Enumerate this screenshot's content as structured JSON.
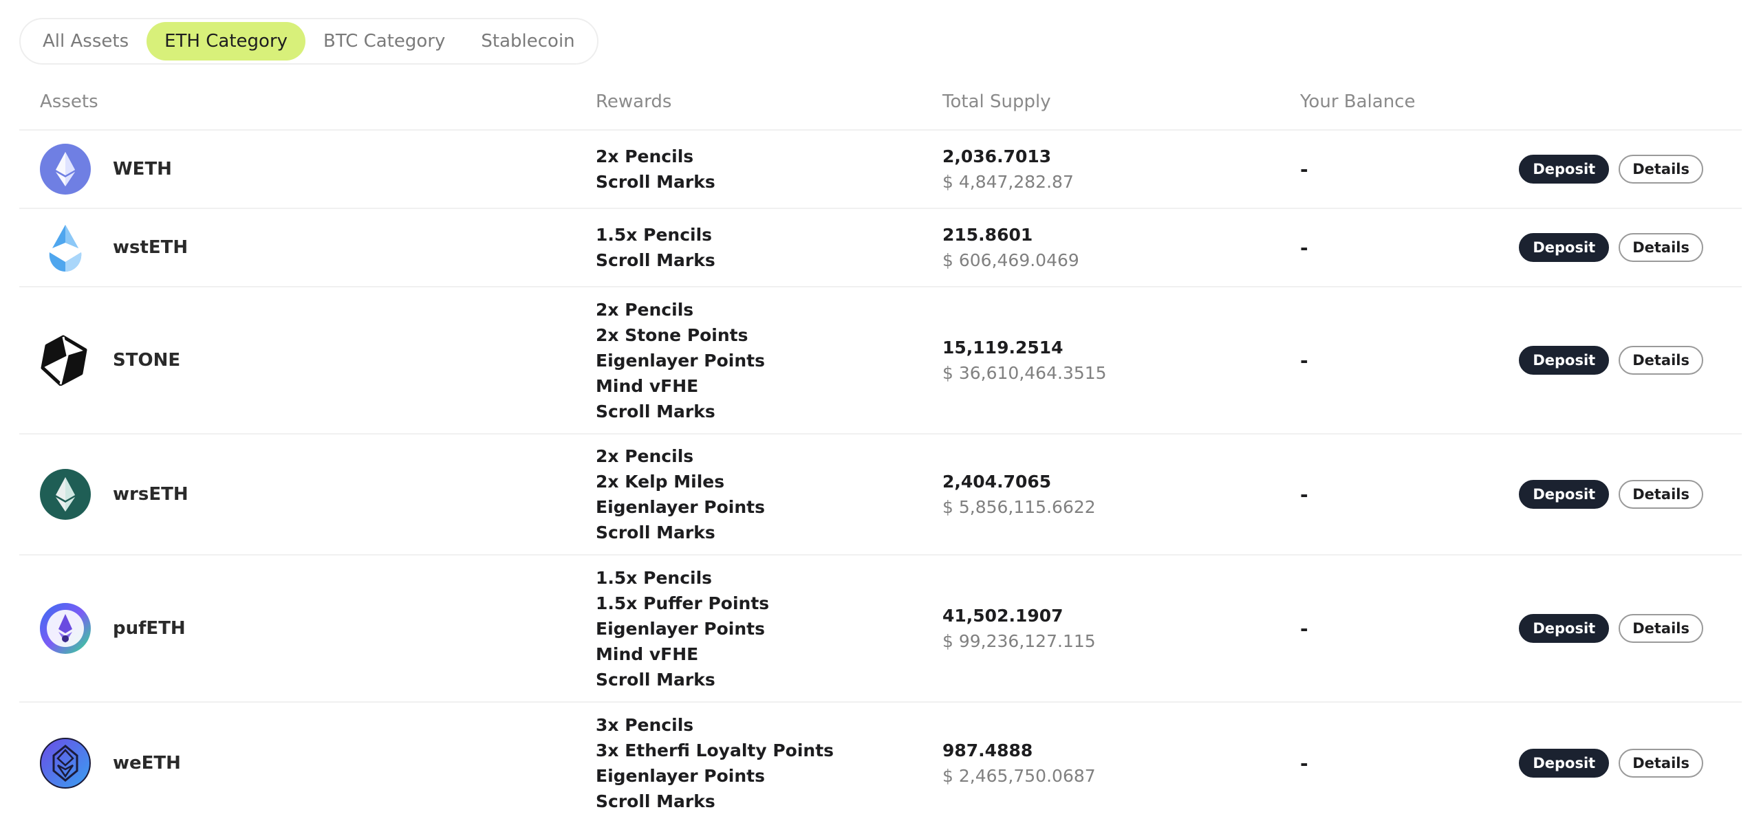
{
  "tabs": [
    {
      "label": "All Assets",
      "active": false
    },
    {
      "label": "ETH Category",
      "active": true
    },
    {
      "label": "BTC Category",
      "active": false
    },
    {
      "label": "Stablecoin",
      "active": false
    }
  ],
  "table": {
    "headers": {
      "assets": "Assets",
      "rewards": "Rewards",
      "total_supply": "Total Supply",
      "your_balance": "Your Balance"
    },
    "rows": [
      {
        "asset": "WETH",
        "icon": "weth-icon",
        "rewards": [
          "2x Pencils",
          "Scroll Marks"
        ],
        "supply_amount": "2,036.7013",
        "supply_usd": "$ 4,847,282.87",
        "balance": "-",
        "deposit_label": "Deposit",
        "details_label": "Details"
      },
      {
        "asset": "wstETH",
        "icon": "wsteth-icon",
        "rewards": [
          "1.5x Pencils",
          "Scroll Marks"
        ],
        "supply_amount": "215.8601",
        "supply_usd": "$ 606,469.0469",
        "balance": "-",
        "deposit_label": "Deposit",
        "details_label": "Details"
      },
      {
        "asset": "STONE",
        "icon": "stone-icon",
        "rewards": [
          "2x Pencils",
          "2x Stone Points",
          "Eigenlayer Points",
          "Mind vFHE",
          "Scroll Marks"
        ],
        "supply_amount": "15,119.2514",
        "supply_usd": "$ 36,610,464.3515",
        "balance": "-",
        "deposit_label": "Deposit",
        "details_label": "Details"
      },
      {
        "asset": "wrsETH",
        "icon": "wrseth-icon",
        "rewards": [
          "2x Pencils",
          "2x Kelp Miles",
          "Eigenlayer Points",
          "Scroll Marks"
        ],
        "supply_amount": "2,404.7065",
        "supply_usd": "$ 5,856,115.6622",
        "balance": "-",
        "deposit_label": "Deposit",
        "details_label": "Details"
      },
      {
        "asset": "pufETH",
        "icon": "pufeth-icon",
        "rewards": [
          "1.5x Pencils",
          "1.5x Puffer Points",
          "Eigenlayer Points",
          "Mind vFHE",
          "Scroll Marks"
        ],
        "supply_amount": "41,502.1907",
        "supply_usd": "$ 99,236,127.115",
        "balance": "-",
        "deposit_label": "Deposit",
        "details_label": "Details"
      },
      {
        "asset": "weETH",
        "icon": "weeth-icon",
        "rewards": [
          "3x Pencils",
          "3x Etherfi Loyalty Points",
          "Eigenlayer Points",
          "Scroll Marks"
        ],
        "supply_amount": "987.4888",
        "supply_usd": "$ 2,465,750.0687",
        "balance": "-",
        "deposit_label": "Deposit",
        "details_label": "Details"
      }
    ]
  },
  "colors": {
    "active_tab": "#d8f07a",
    "deposit_button": "#1b2230",
    "divider": "#f0f0f0"
  }
}
